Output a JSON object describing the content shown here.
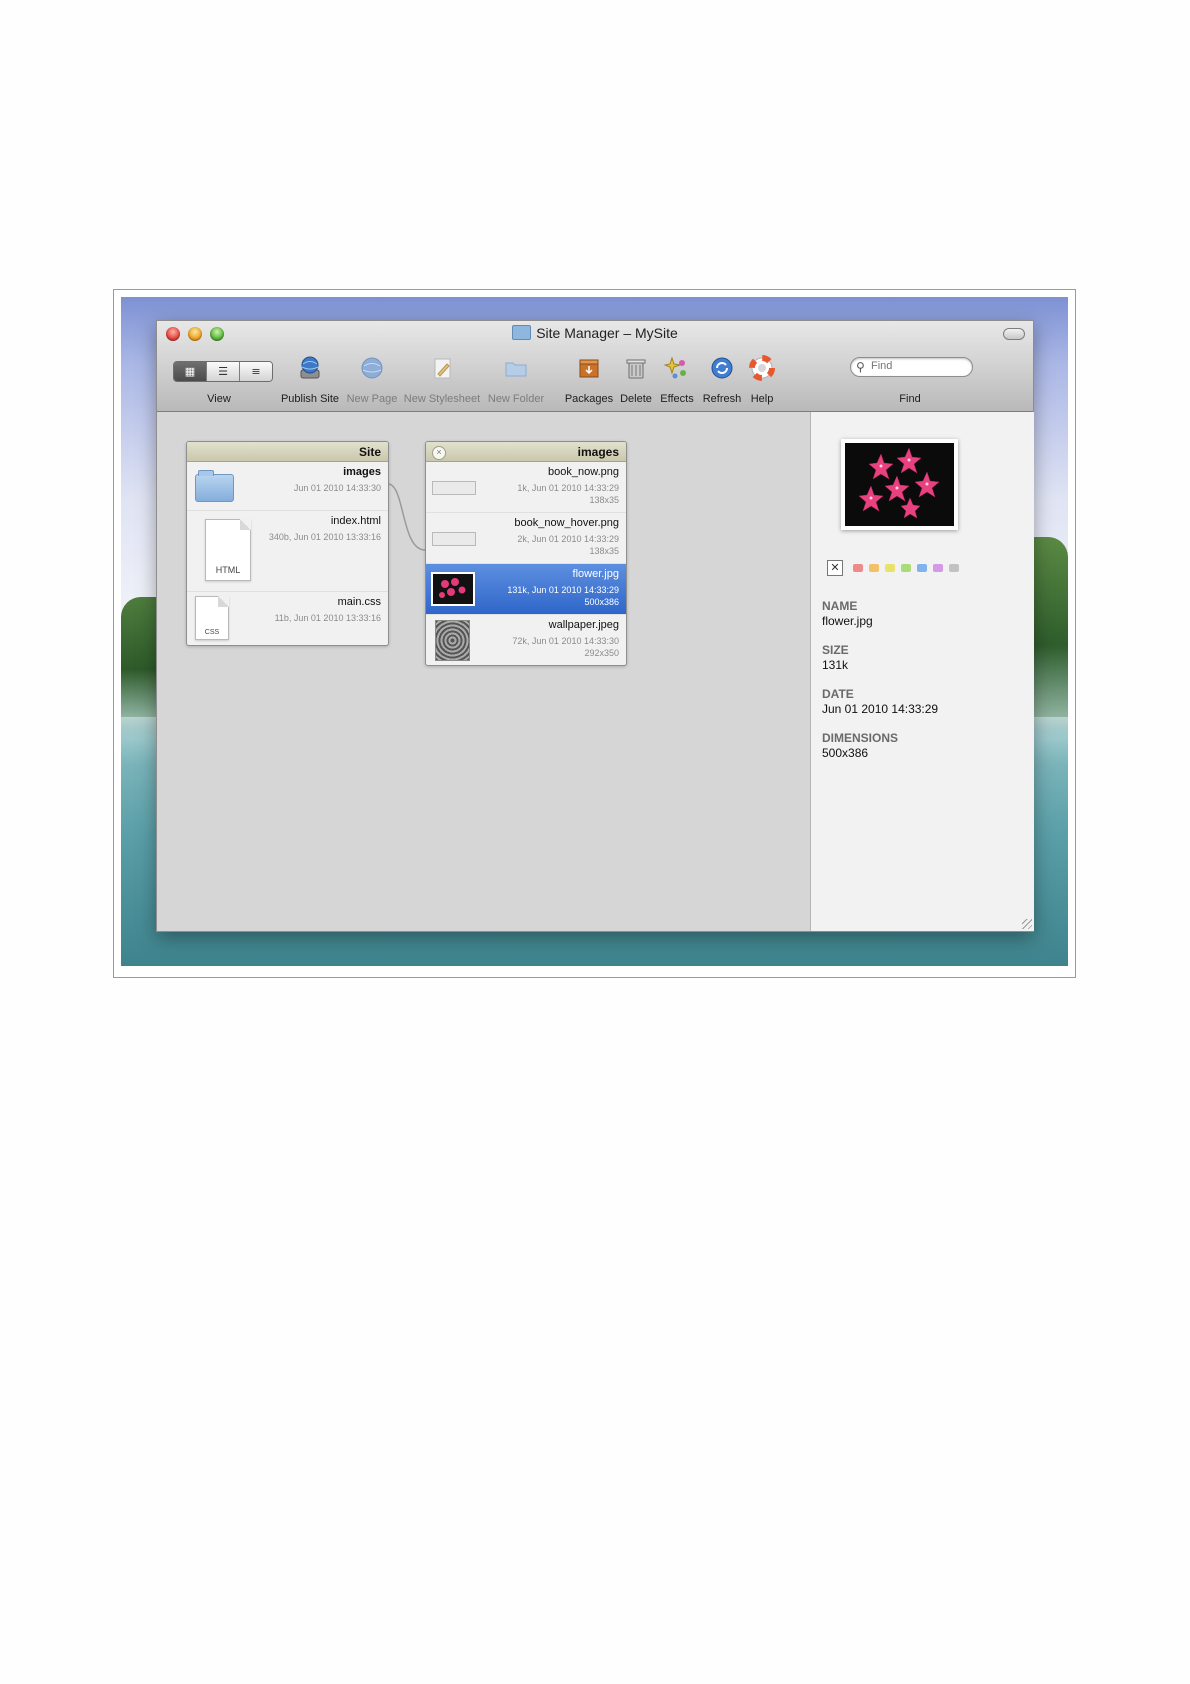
{
  "window": {
    "title": "Site Manager – MySite"
  },
  "toolbar": {
    "view_label": "View",
    "view_modes": [
      "icon-view",
      "list-view",
      "column-view"
    ],
    "items": [
      {
        "label": "Publish Site",
        "icon": "globe-disk-icon",
        "enabled": true
      },
      {
        "label": "New Page",
        "icon": "globe-icon",
        "enabled": false
      },
      {
        "label": "New Stylesheet",
        "icon": "pencil-doc-icon",
        "enabled": false
      },
      {
        "label": "New Folder",
        "icon": "folder-icon",
        "enabled": false
      },
      {
        "label": "Packages",
        "icon": "package-box-icon",
        "enabled": true
      },
      {
        "label": "Delete",
        "icon": "trash-icon",
        "enabled": true
      },
      {
        "label": "Effects",
        "icon": "sparkle-icon",
        "enabled": true
      },
      {
        "label": "Refresh",
        "icon": "refresh-icon",
        "enabled": true
      },
      {
        "label": "Help",
        "icon": "lifebuoy-icon",
        "enabled": true
      }
    ],
    "find_label": "Find",
    "search_placeholder": "Find"
  },
  "site_panel": {
    "title": "Site",
    "items": [
      {
        "name": "images",
        "meta": "Jun 01 2010 14:33:30",
        "kind": "folder"
      },
      {
        "name": "index.html",
        "meta": "340b, Jun 01 2010 13:33:16",
        "kind": "html",
        "badge": "HTML"
      },
      {
        "name": "main.css",
        "meta": "11b, Jun 01 2010 13:33:16",
        "kind": "css",
        "badge": "CSS"
      }
    ]
  },
  "images_panel": {
    "title": "images",
    "items": [
      {
        "name": "book_now.png",
        "meta1": "1k, Jun 01 2010 14:33:29",
        "meta2": "138x35"
      },
      {
        "name": "book_now_hover.png",
        "meta1": "2k, Jun 01 2010 14:33:29",
        "meta2": "138x35"
      },
      {
        "name": "flower.jpg",
        "meta1": "131k, Jun 01 2010 14:33:29",
        "meta2": "500x386",
        "selected": true
      },
      {
        "name": "wallpaper.jpeg",
        "meta1": "72k, Jun 01 2010 14:33:30",
        "meta2": "292x350"
      }
    ]
  },
  "inspector": {
    "label_colors": [
      "#f08a8a",
      "#f3c069",
      "#e9e26a",
      "#a9dc78",
      "#83b3ef",
      "#d59ae6",
      "#c2c2c2"
    ],
    "fields": [
      {
        "key": "NAME",
        "value": "flower.jpg"
      },
      {
        "key": "SIZE",
        "value": "131k"
      },
      {
        "key": "DATE",
        "value": "Jun 01 2010 14:33:29"
      },
      {
        "key": "DIMENSIONS",
        "value": "500x386"
      }
    ]
  }
}
